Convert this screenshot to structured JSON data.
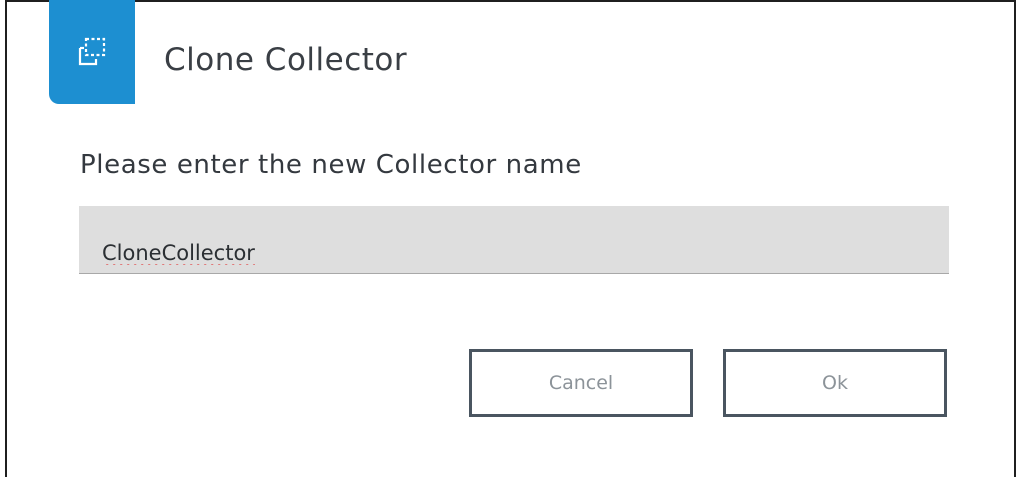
{
  "dialog": {
    "title": "Clone Collector",
    "icon": "clone-icon",
    "accent_color": "#1d8fd1",
    "prompt": "Please enter the new Collector name",
    "input": {
      "value": "CloneCollector",
      "placeholder": ""
    },
    "buttons": {
      "cancel_label": "Cancel",
      "ok_label": "Ok"
    }
  }
}
